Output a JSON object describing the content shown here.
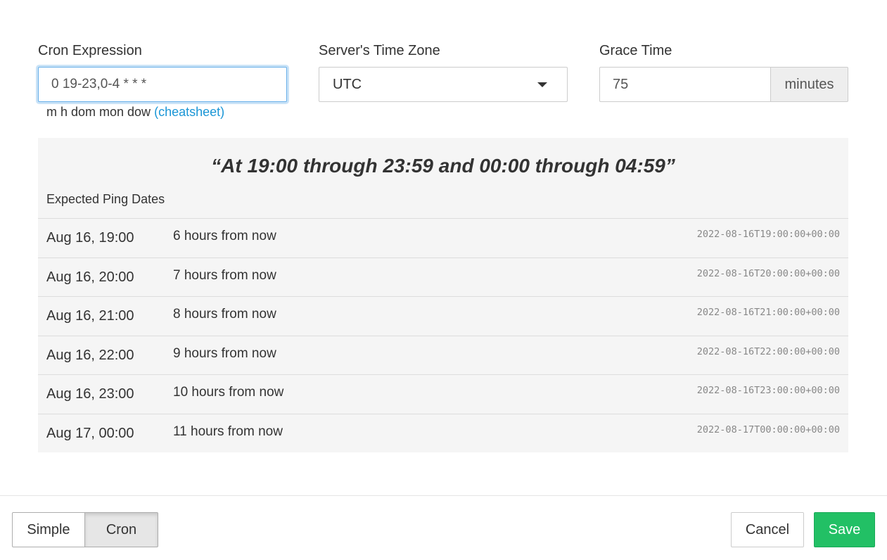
{
  "fields": {
    "cron_label": "Cron Expression",
    "cron_value": "0 19-23,0-4 * * *",
    "hint_text": "m h dom mon dow",
    "hint_link": "(cheatsheet)",
    "timezone_label": "Server's Time Zone",
    "timezone_value": "UTC",
    "grace_label": "Grace Time",
    "grace_value": "75",
    "grace_unit": "minutes"
  },
  "preview": {
    "description": "“At 19:00 through 23:59 and 00:00 through 04:59”",
    "section_title": "Expected Ping Dates",
    "rows": [
      {
        "date": "Aug 16, 19:00",
        "relative": "6 hours from now",
        "iso": "2022-08-16T19:00:00+00:00"
      },
      {
        "date": "Aug 16, 20:00",
        "relative": "7 hours from now",
        "iso": "2022-08-16T20:00:00+00:00"
      },
      {
        "date": "Aug 16, 21:00",
        "relative": "8 hours from now",
        "iso": "2022-08-16T21:00:00+00:00"
      },
      {
        "date": "Aug 16, 22:00",
        "relative": "9 hours from now",
        "iso": "2022-08-16T22:00:00+00:00"
      },
      {
        "date": "Aug 16, 23:00",
        "relative": "10 hours from now",
        "iso": "2022-08-16T23:00:00+00:00"
      },
      {
        "date": "Aug 17, 00:00",
        "relative": "11 hours from now",
        "iso": "2022-08-17T00:00:00+00:00"
      }
    ]
  },
  "footer": {
    "simple_label": "Simple",
    "cron_label": "Cron",
    "active_mode": "Cron",
    "cancel_label": "Cancel",
    "save_label": "Save"
  },
  "colors": {
    "accent_link": "#1a96d6",
    "save_green": "#22c065",
    "focus_border": "#66afe9",
    "panel_bg": "#f5f5f5"
  }
}
